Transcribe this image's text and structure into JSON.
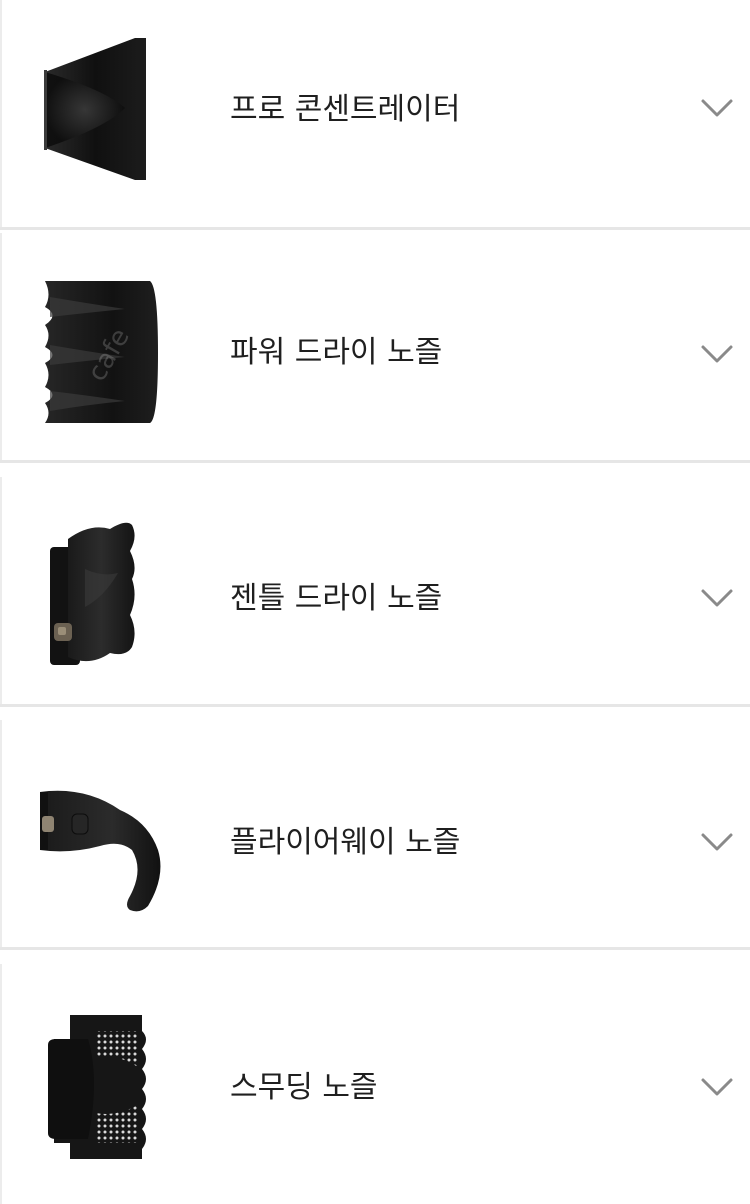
{
  "accessories": [
    {
      "label": "프로 콘센트레이터",
      "icon": "pro-concentrator-icon",
      "expand_icon": "chevron-down-icon"
    },
    {
      "label": "파워 드라이 노즐",
      "icon": "power-dry-nozzle-icon",
      "expand_icon": "chevron-down-icon"
    },
    {
      "label": "젠틀 드라이 노즐",
      "icon": "gentle-dry-nozzle-icon",
      "expand_icon": "chevron-down-icon"
    },
    {
      "label": "플라이어웨이 노즐",
      "icon": "flyaway-nozzle-icon",
      "expand_icon": "chevron-down-icon"
    },
    {
      "label": "스무딩 노즐",
      "icon": "smoothing-nozzle-icon",
      "expand_icon": "chevron-down-icon"
    }
  ],
  "watermark": "cafe",
  "colors": {
    "text": "#1f1f1f",
    "divider": "#e6e6e6",
    "chevron": "#8a8a8a",
    "nozzle": "#161616"
  }
}
